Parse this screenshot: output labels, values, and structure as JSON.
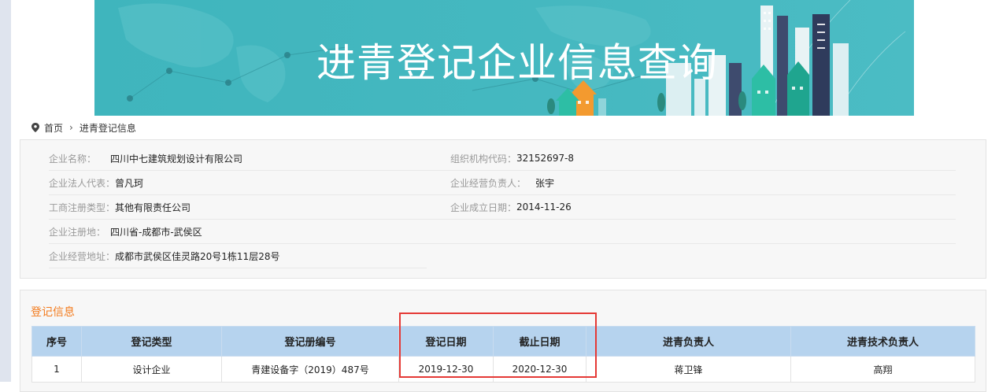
{
  "banner": {
    "title": "进青登记企业信息查询"
  },
  "breadcrumb": {
    "home": "首页",
    "separator": "›",
    "current": "进青登记信息"
  },
  "company": {
    "name_label": "企业名称：",
    "name_value": "四川中七建筑规划设计有限公司",
    "org_code_label": "组织机构代码：",
    "org_code_value": "32152697-8",
    "legal_rep_label": "企业法人代表：",
    "legal_rep_value": "曾凡珂",
    "manager_label": "企业经营负责人：",
    "manager_value": "张宇",
    "reg_type_label": "工商注册类型：",
    "reg_type_value": "其他有限责任公司",
    "founded_label": "企业成立日期：",
    "founded_value": "2014-11-26",
    "reg_place_label": "企业注册地：",
    "reg_place_value": "四川省-成都市-武侯区",
    "address_label": "企业经营地址：",
    "address_value": "成都市武侯区佳灵路20号1栋11层28号"
  },
  "registration": {
    "section_title": "登记信息",
    "columns": [
      "序号",
      "登记类型",
      "登记册编号",
      "登记日期",
      "截止日期",
      "进青负责人",
      "进青技术负责人"
    ],
    "rows": [
      [
        "1",
        "设计企业",
        "青建设备字（2019）487号",
        "2019-12-30",
        "2020-12-30",
        "蒋卫锋",
        "高翔"
      ]
    ]
  },
  "colors": {
    "banner_bg": "#45b8c0",
    "section_title": "#f37b1d",
    "table_header": "#b6d3ee",
    "highlight": "#e53935"
  }
}
